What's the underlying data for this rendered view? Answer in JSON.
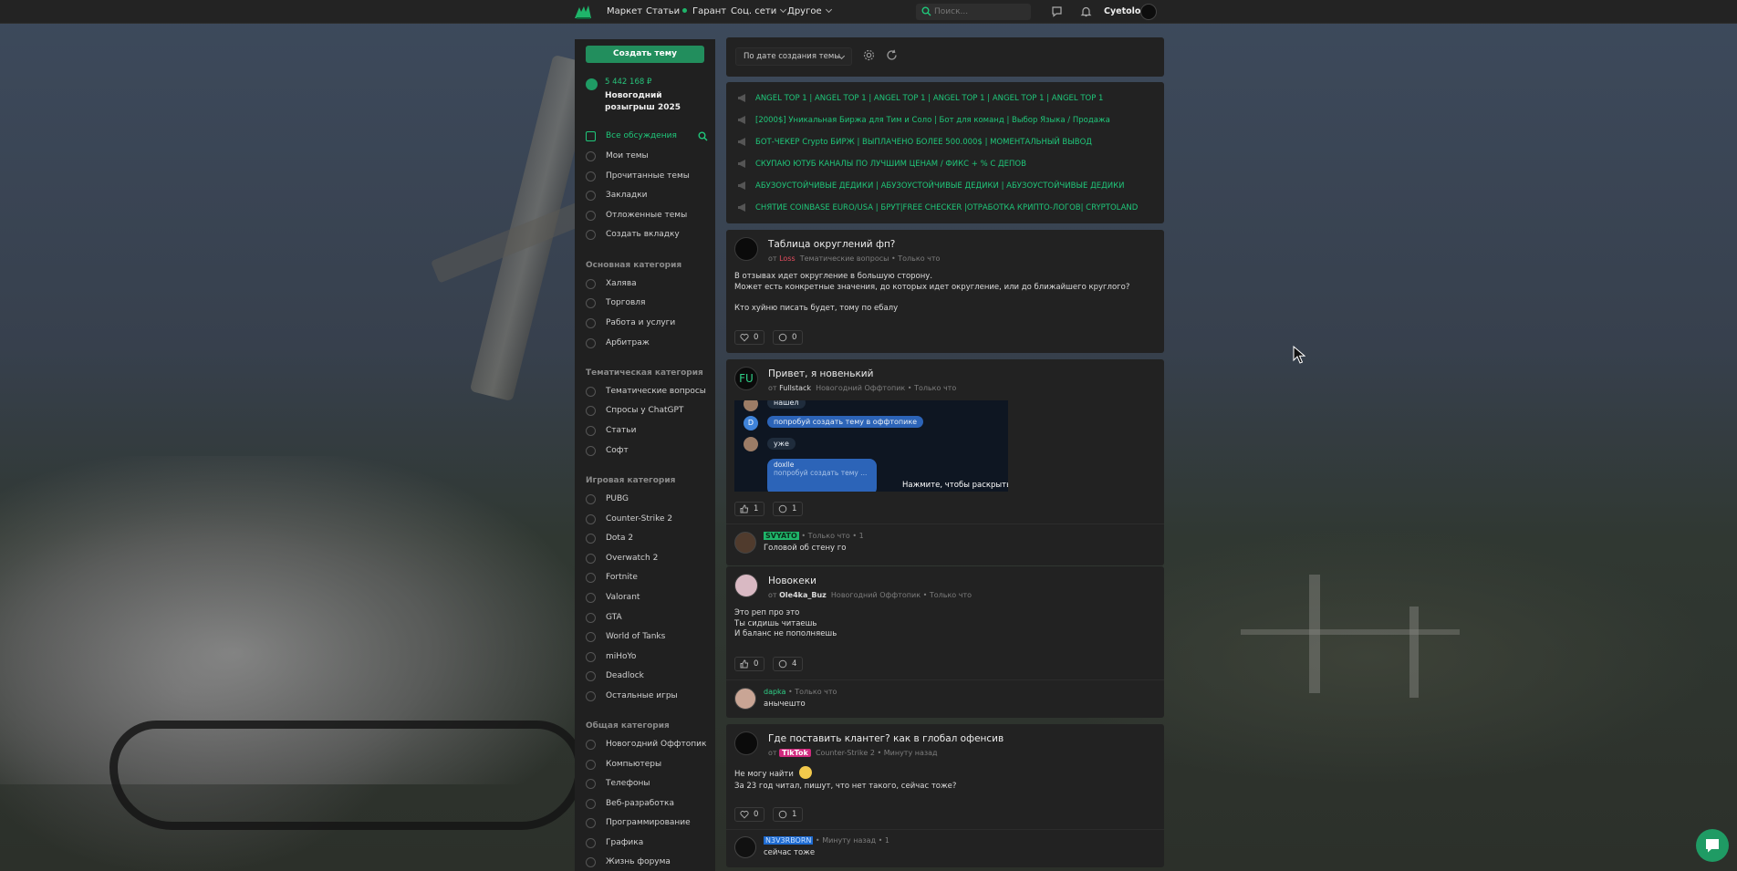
{
  "nav": {
    "items": [
      "Маркет",
      "Статьи",
      "Гарант",
      "Соц. сети",
      "Другое"
    ],
    "search_placeholder": "Поиск...",
    "username": "Cyetolog",
    "accent": "#1fc77a"
  },
  "sidebar": {
    "create_button": "Создать тему",
    "promo": {
      "amount": "5 442 168 ₽",
      "title": "Новогодний розыгрыш 2025"
    },
    "personal": [
      "Все обсуждения",
      "Мои темы",
      "Прочитанные темы",
      "Закладки",
      "Отложенные темы",
      "Создать вкладку"
    ],
    "groups": [
      {
        "title": "Основная категория",
        "items": [
          "Халява",
          "Торговля",
          "Работа и услуги",
          "Арбитраж"
        ]
      },
      {
        "title": "Тематическая категория",
        "items": [
          "Тематические вопросы",
          "Спросы у ChatGPT",
          "Статьи",
          "Софт"
        ]
      },
      {
        "title": "Игровая категория",
        "items": [
          "PUBG",
          "Counter-Strike 2",
          "Dota 2",
          "Overwatch 2",
          "Fortnite",
          "Valorant",
          "GTA",
          "World of Tanks",
          "miHoYo",
          "Deadlock",
          "Остальные игры"
        ]
      },
      {
        "title": "Общая категория",
        "items": [
          "Новогодний Оффтопик",
          "Компьютеры",
          "Телефоны",
          "Веб-разработка",
          "Программирование",
          "Графика",
          "Жизнь форума"
        ]
      }
    ]
  },
  "toolbar": {
    "sort": "По дате создания темы"
  },
  "sticky": [
    "ANGEL TOP 1 | ANGEL TOP 1 | ANGEL TOP 1 | ANGEL TOP 1 | ANGEL TOP 1 | ANGEL TOP 1",
    "[2000$] Уникальная Биржа для Тим и Соло | Бот для команд | Выбор Языка / Продажа",
    "БОТ-ЧЕКЕР Crypto БИРЖ | ВЫПЛАЧЕНО БОЛЕЕ 500.000$ | МОМЕНТАЛЬНЫЙ ВЫВОД",
    "СКУПАЮ ЮТУБ КАНАЛЫ ПО ЛУЧШИМ ЦЕНАМ / ФИКС + % С ДЕПОВ",
    "АБУЗОУСТОЙЧИВЫЕ ДЕДИКИ | АБУЗОУСТОЙЧИВЫЕ ДЕДИКИ | АБУЗОУСТОЙЧИВЫЕ ДЕДИКИ",
    "СНЯТИЕ COINBASE EURO/USA | БРУТ|FREE CHECKER |ОТРАБОТКА КРИПТО-ЛОГОВ| CRYPTOLAND"
  ],
  "posts": [
    {
      "title": "Таблица округлений фп?",
      "by": "от",
      "author": "Loss",
      "category": "Тематические вопросы",
      "time": "Только что",
      "body": "В отзывах идет округление в большую сторону.\nМожет есть конкретные значения, до которых идет округление, или до ближайшего круглого?\n\nКто хуйню писать будет, тому по ебалу",
      "likes": "0",
      "comments": "0"
    },
    {
      "title": "Привет, я новенький",
      "by": "от",
      "author": "Fullstack",
      "category": "Новогодний Оффтопик",
      "time": "Только что",
      "avatar_text": "FU",
      "image": {
        "msg1": "нашёл",
        "msg2": "попробуй создать тему в оффтопике",
        "msg3": "уже",
        "msg4": "doxlle",
        "msg5": "попробуй создать тему ...",
        "expand": "Нажмите, чтобы раскрыть..."
      },
      "likes": "1",
      "comments": "1",
      "reply": {
        "user": "SVYATO",
        "time": "Только что",
        "likes": "1",
        "text": "Головой об стену го"
      }
    },
    {
      "title": "Новокеки",
      "by": "от",
      "author": "Ole4ka_Buz",
      "category": "Новогодний Оффтопик",
      "time": "Только что",
      "body": "Это реп про это\nТы сидишь читаешь\nИ баланс не пополняешь",
      "likes": "0",
      "comments": "4",
      "reply": {
        "user": "dapka",
        "time": "Только что",
        "text": "анычешто"
      }
    },
    {
      "title": "Где поставить клантег? как в глобал офенсив",
      "by": "от",
      "author": "TikTok",
      "category": "Counter-Strike 2",
      "time": "Минуту назад",
      "body_line1": "Не могу найти",
      "body_line2": "За 23 год читал, пишут, что нет такого, сейчас тоже?",
      "likes": "0",
      "comments": "1",
      "reply": {
        "user": "N3V3RBORN",
        "time": "Минуту назад",
        "likes": "1",
        "text": "сейчас тоже"
      }
    }
  ]
}
